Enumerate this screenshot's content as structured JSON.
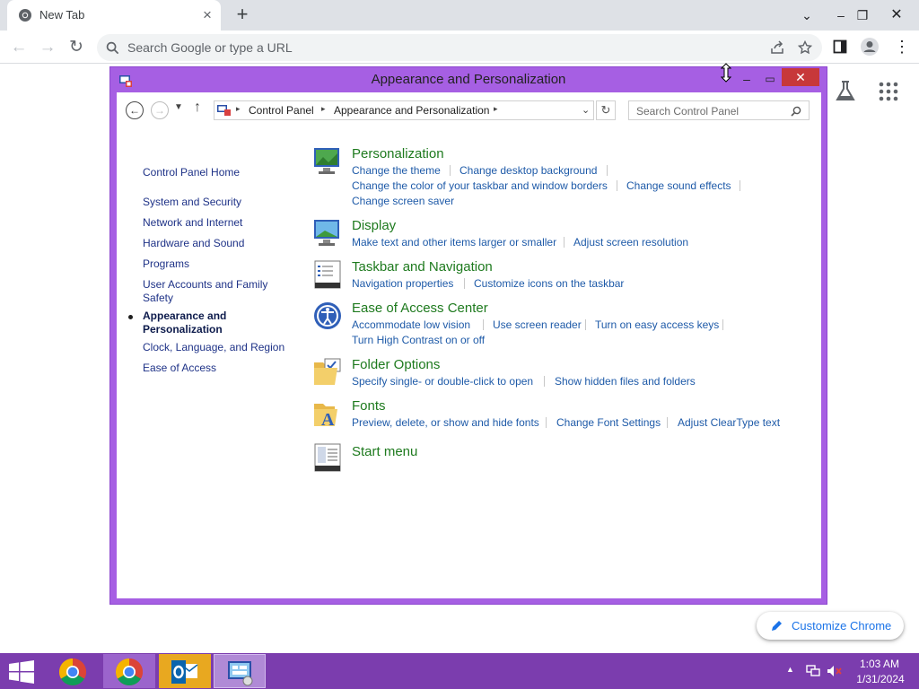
{
  "browser": {
    "tab_title": "New Tab",
    "omnibox_placeholder": "Search Google or type a URL",
    "customize_label": "Customize Chrome"
  },
  "window": {
    "title": "Appearance and Personalization",
    "breadcrumb": [
      "Control Panel",
      "Appearance and Personalization"
    ],
    "search_placeholder": "Search Control Panel"
  },
  "sidebar": {
    "items": [
      {
        "label": "Control Panel Home"
      },
      {
        "label": "System and Security"
      },
      {
        "label": "Network and Internet"
      },
      {
        "label": "Hardware and Sound"
      },
      {
        "label": "Programs"
      },
      {
        "label": "User Accounts and Family Safety"
      },
      {
        "label": "Appearance and Personalization"
      },
      {
        "label": "Clock, Language, and Region"
      },
      {
        "label": "Ease of Access"
      }
    ]
  },
  "sections": [
    {
      "title": "Personalization",
      "links": [
        "Change the theme",
        "Change desktop background",
        "Change the color of your taskbar and window borders",
        "Change sound effects",
        "Change screen saver"
      ]
    },
    {
      "title": "Display",
      "links": [
        "Make text and other items larger or smaller",
        "Adjust screen resolution"
      ]
    },
    {
      "title": "Taskbar and Navigation",
      "links": [
        "Navigation properties",
        "Customize icons on the taskbar"
      ]
    },
    {
      "title": "Ease of Access Center",
      "links": [
        "Accommodate low vision",
        "Use screen reader",
        "Turn on easy access keys",
        "Turn High Contrast on or off"
      ]
    },
    {
      "title": "Folder Options",
      "links": [
        "Specify single- or double-click to open",
        "Show hidden files and folders"
      ]
    },
    {
      "title": "Fonts",
      "links": [
        "Preview, delete, or show and hide fonts",
        "Change Font Settings",
        "Adjust ClearType text"
      ]
    },
    {
      "title": "Start menu",
      "links": []
    }
  ],
  "taskbar": {
    "time": "1:03 AM",
    "date": "1/31/2024"
  },
  "colors": {
    "window_frame": "#a65fe3",
    "taskbar": "#7b3dae",
    "link": "#1e5aa8",
    "section_title": "#1e7a1e"
  }
}
